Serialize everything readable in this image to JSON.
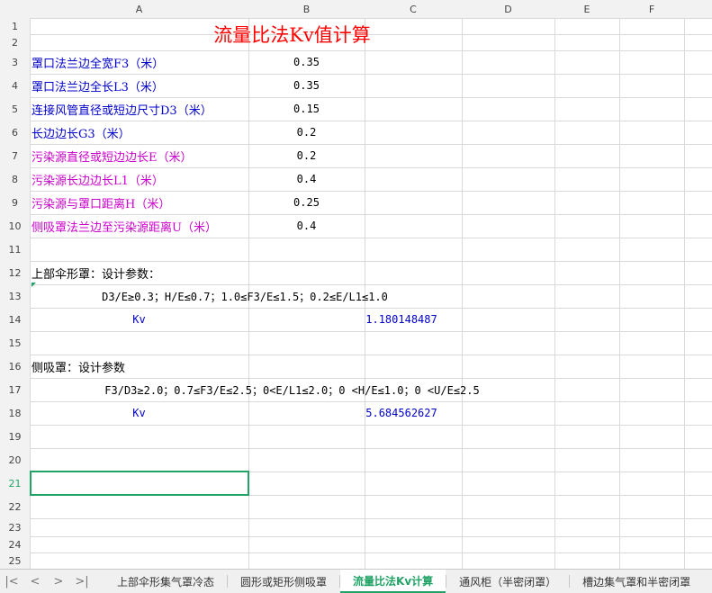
{
  "columns": [
    "A",
    "B",
    "C",
    "D",
    "E",
    "F"
  ],
  "rows": [
    "1",
    "2",
    "3",
    "4",
    "5",
    "6",
    "7",
    "8",
    "9",
    "10",
    "11",
    "12",
    "13",
    "14",
    "15",
    "16",
    "17",
    "18",
    "19",
    "20",
    "21",
    "22",
    "23",
    "24",
    "25"
  ],
  "active_row": "21",
  "title": "流量比法Kv值计算",
  "params": [
    {
      "label": "罩口法兰边全宽F3（米）",
      "value": "0.35",
      "color": "#0000cc"
    },
    {
      "label": "罩口法兰边全长L3（米）",
      "value": "0.35",
      "color": "#0000cc"
    },
    {
      "label": "连接风管直径或短边尺寸D3（米）",
      "value": "0.15",
      "color": "#0000cc"
    },
    {
      "label": "长边边长G3（米）",
      "value": "0.2",
      "color": "#0000cc"
    },
    {
      "label": "污染源直径或短边边长E（米）",
      "value": "0.2",
      "color": "#cc00cc"
    },
    {
      "label": "污染源长边边长L1（米）",
      "value": "0.4",
      "color": "#cc00cc"
    },
    {
      "label": "污染源与罩口距离H（米）",
      "value": "0.25",
      "color": "#cc00cc"
    },
    {
      "label": "侧吸罩法兰边至污染源距离U（米）",
      "value": "0.4",
      "color": "#cc00cc"
    }
  ],
  "umbrella": {
    "heading": "上部伞形罩：设计参数：",
    "condition": "D3/E≥0.3；H/E≤0.7；1.0≤F3/E≤1.5；0.2≤E/L1≤1.0",
    "kv_label": "Kv",
    "kv_value": "1.180148487"
  },
  "side": {
    "heading": "侧吸罩：设计参数",
    "condition": "F3/D3≥2.0；0.7≤F3/E≤2.5；0<E/L1≤2.0；0 <H/E≤1.0；0 <U/E≤2.5",
    "kv_label": "Kv",
    "kv_value": "5.684562627"
  },
  "tabs": [
    {
      "label": "上部伞形集气罩冷态",
      "active": false
    },
    {
      "label": "圆形或矩形侧吸罩",
      "active": false
    },
    {
      "label": "流量比法Kv计算",
      "active": true
    },
    {
      "label": "通风柜（半密闭罩）",
      "active": false
    },
    {
      "label": "槽边集气罩和半密闭罩",
      "active": false
    }
  ],
  "nav": {
    "first": "|<",
    "prev": "<",
    "next": ">",
    "last": ">|"
  },
  "colors": {
    "accent": "#21a366",
    "title": "#ff0000",
    "blue": "#0000cc",
    "magenta": "#cc00cc"
  }
}
